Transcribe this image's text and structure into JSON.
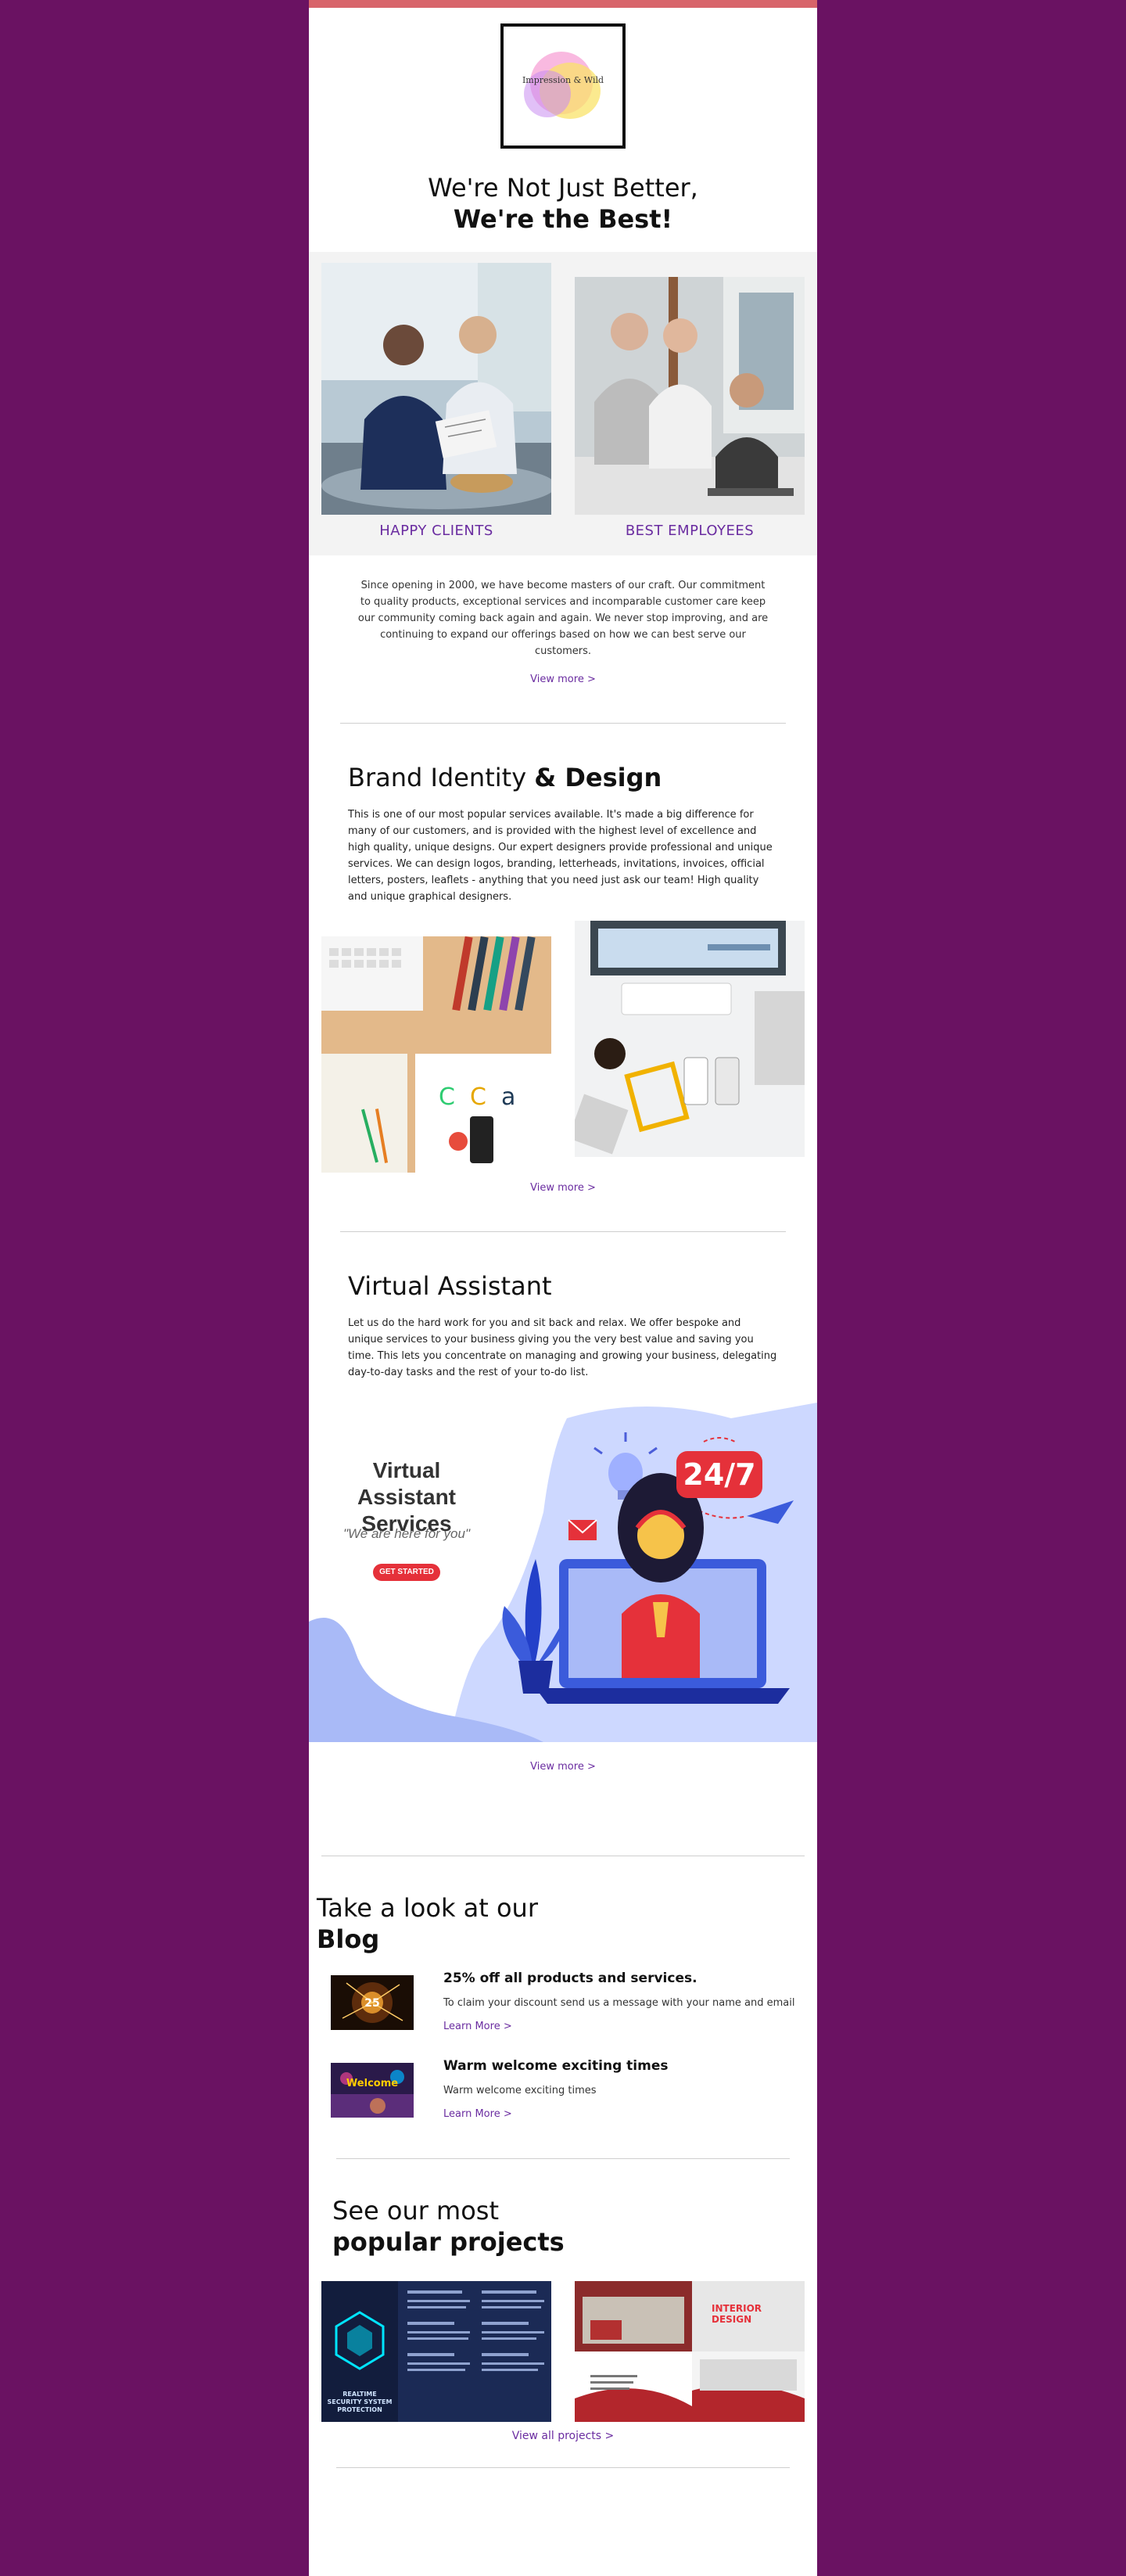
{
  "logo": {
    "text": "Impression & Wild"
  },
  "hero": {
    "line1": "We're Not Just Better,",
    "line2": "We're the Best!"
  },
  "duo": {
    "left_caption": "HAPPY CLIENTS",
    "right_caption": "BEST EMPLOYEES"
  },
  "intro": {
    "text": "Since opening in 2000, we have become masters of our craft. Our commitment to quality products, exceptional services and incomparable customer care keep our community coming back again and again. We never stop improving, and are continuing to expand our offerings based on how we can best serve our customers.",
    "view_more": "View more  >"
  },
  "brand": {
    "title_light": "Brand Identity ",
    "title_bold": "& Design",
    "body": "This is one of our most popular services available. It's made a big difference for many of our customers, and is provided with the highest level of excellence and high quality, unique designs. Our expert designers provide professional and unique services. We can design logos, branding, letterheads, invitations, invoices, official letters, posters, leaflets - anything that you need just ask our team! High quality and unique graphical designers.",
    "view_more": "View more  >"
  },
  "va": {
    "title": "Virtual Assistant",
    "body": "Let us do the hard work for you and sit back and relax. We offer bespoke and unique services to your business giving you the very best value and saving you time. This lets you concentrate on managing and growing your business, delegating day-to-day tasks and the rest of your to-do list.",
    "banner_title_1": "Virtual Assistant",
    "banner_title_2": "Services",
    "banner_quote": "\"We are here for you\"",
    "banner_button": "GET STARTED",
    "banner_badge": "24/7",
    "view_more": "View more  >"
  },
  "blog": {
    "heading_light": "Take a look at our",
    "heading_bold": "Blog",
    "items": [
      {
        "title": "25% off all products and services.",
        "desc": "To claim your discount send us a message with your name and email",
        "link": "Learn More  >",
        "thumb_text": "25"
      },
      {
        "title": "Warm welcome exciting times",
        "desc": "Warm welcome exciting times",
        "link": "Learn More  >",
        "thumb_text": "Welcome"
      }
    ]
  },
  "projects": {
    "heading_light": "See our most",
    "heading_bold": "popular projects",
    "left_label": "REALTIME SECURITY SYSTEM PROTECTION",
    "right_label": "INTERIOR DESIGN",
    "view_all": "View all projects  >"
  },
  "colors": {
    "background": "#6a1262",
    "accent": "#6a2ca0",
    "topbar": "#d8646a"
  }
}
